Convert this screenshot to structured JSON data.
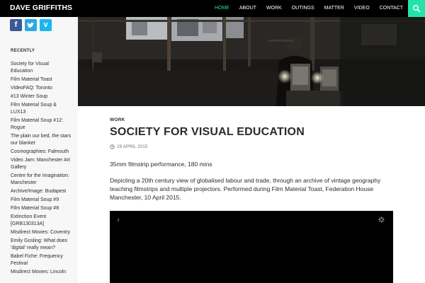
{
  "header": {
    "site_title": "DAVE GRIFFITHS",
    "nav": [
      "HOME",
      "ABOUT",
      "WORK",
      "OUTINGS",
      "MATTER",
      "VIDEO",
      "CONTACT"
    ],
    "active_nav": "HOME",
    "accent": "#24e3a9"
  },
  "sidebar": {
    "social": [
      "facebook-icon",
      "twitter-icon",
      "vimeo-icon"
    ],
    "recent_heading": "RECENTLY",
    "recent": [
      "Society for Visual Education",
      "Film Material Toast",
      "VideoFAQ: Toronto",
      "#13 Winter Soup",
      "Film Material Soup & LUX13",
      "Film Material Soup #12: Rogue",
      "The plain our bed, the stars our blanket",
      "Cosmographies: Falmouth",
      "Video Jam: Manchester Art Gallery",
      "Centre for the Imagination: Manchester",
      "Archive/Image: Budapest",
      "Film Material Soup #9",
      "Film Material Soup #8",
      "Extinction Event [GRB130313A]",
      "Misdirect Movies: Coventry",
      "Emily Gosling: What does 'digital' really mean?",
      "Babel Fiche: Frequency Festival",
      "Misdirect Movies: Lincoln"
    ]
  },
  "article": {
    "category": "WORK",
    "title": "SOCIETY FOR VISUAL EDUCATION",
    "date": "29 APRIL 2015",
    "paragraph1": "35mm filmstrip performance, 180 mins",
    "paragraph2": "Depicting a 20th century view of globalised labour and trade, through an archive of vintage geography teaching filmstrips and multiple projectors. Performed during Film Material Toast, Federation House Manchester, 10 April 2015.",
    "video_info": "i"
  }
}
